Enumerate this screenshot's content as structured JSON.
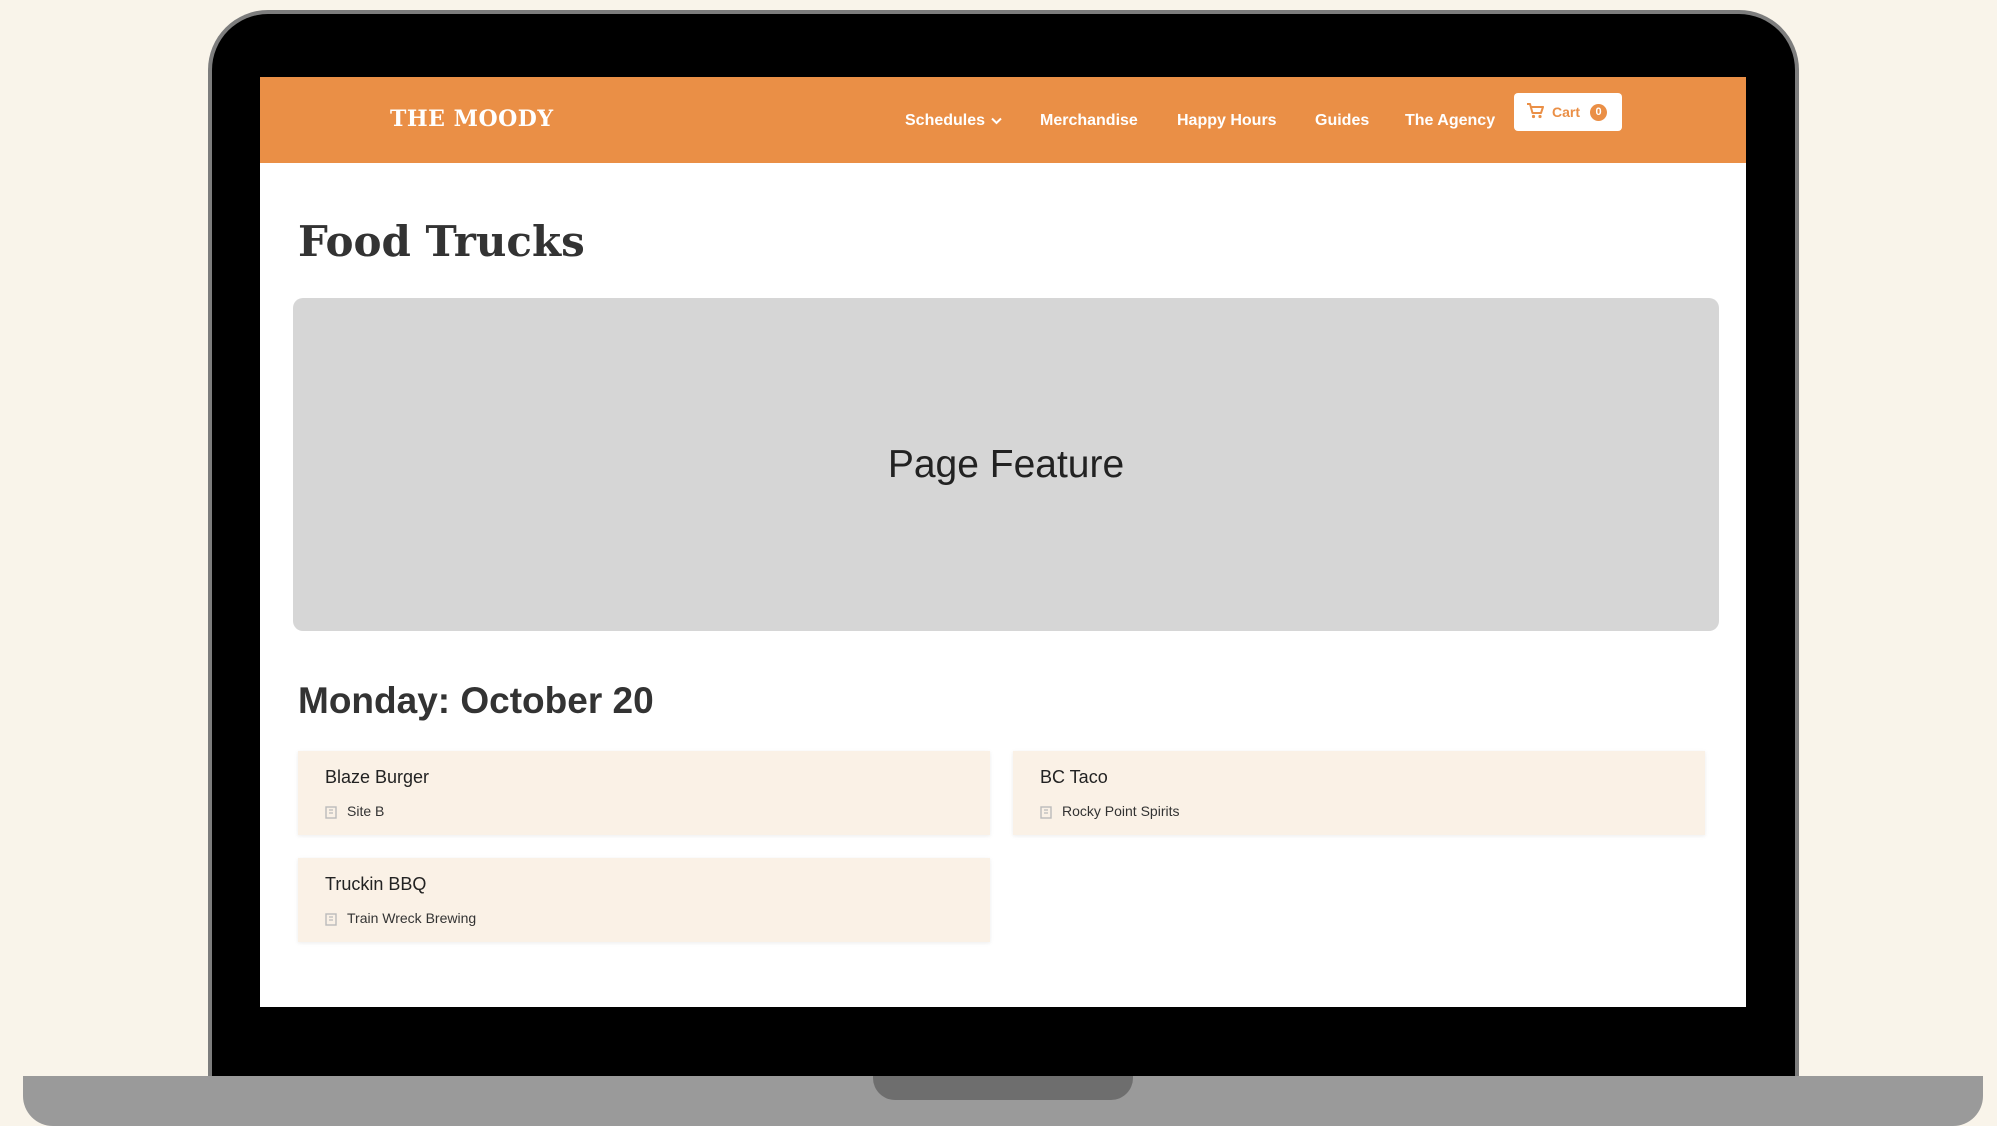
{
  "site": {
    "logo": "THE MOODY",
    "nav": [
      {
        "label": "Schedules"
      },
      {
        "label": "Merchandise"
      },
      {
        "label": "Happy Hours"
      },
      {
        "label": "Guides"
      },
      {
        "label": "The Agency"
      }
    ],
    "cart": {
      "label": "Cart",
      "count": "0"
    }
  },
  "page": {
    "title": "Food Trucks",
    "feature_label": "Page Feature",
    "day_heading": "Monday: October 20",
    "trucks": [
      {
        "name": "Blaze Burger",
        "location": "Site B"
      },
      {
        "name": "BC Taco",
        "location": "Rocky Point Spirits"
      },
      {
        "name": "Truckin BBQ",
        "location": "Train Wreck Brewing"
      }
    ]
  },
  "colors": {
    "brand": "#ea8f46",
    "background": "#f9f4ea",
    "card": "#faf1e6",
    "feature": "#d6d6d6"
  }
}
